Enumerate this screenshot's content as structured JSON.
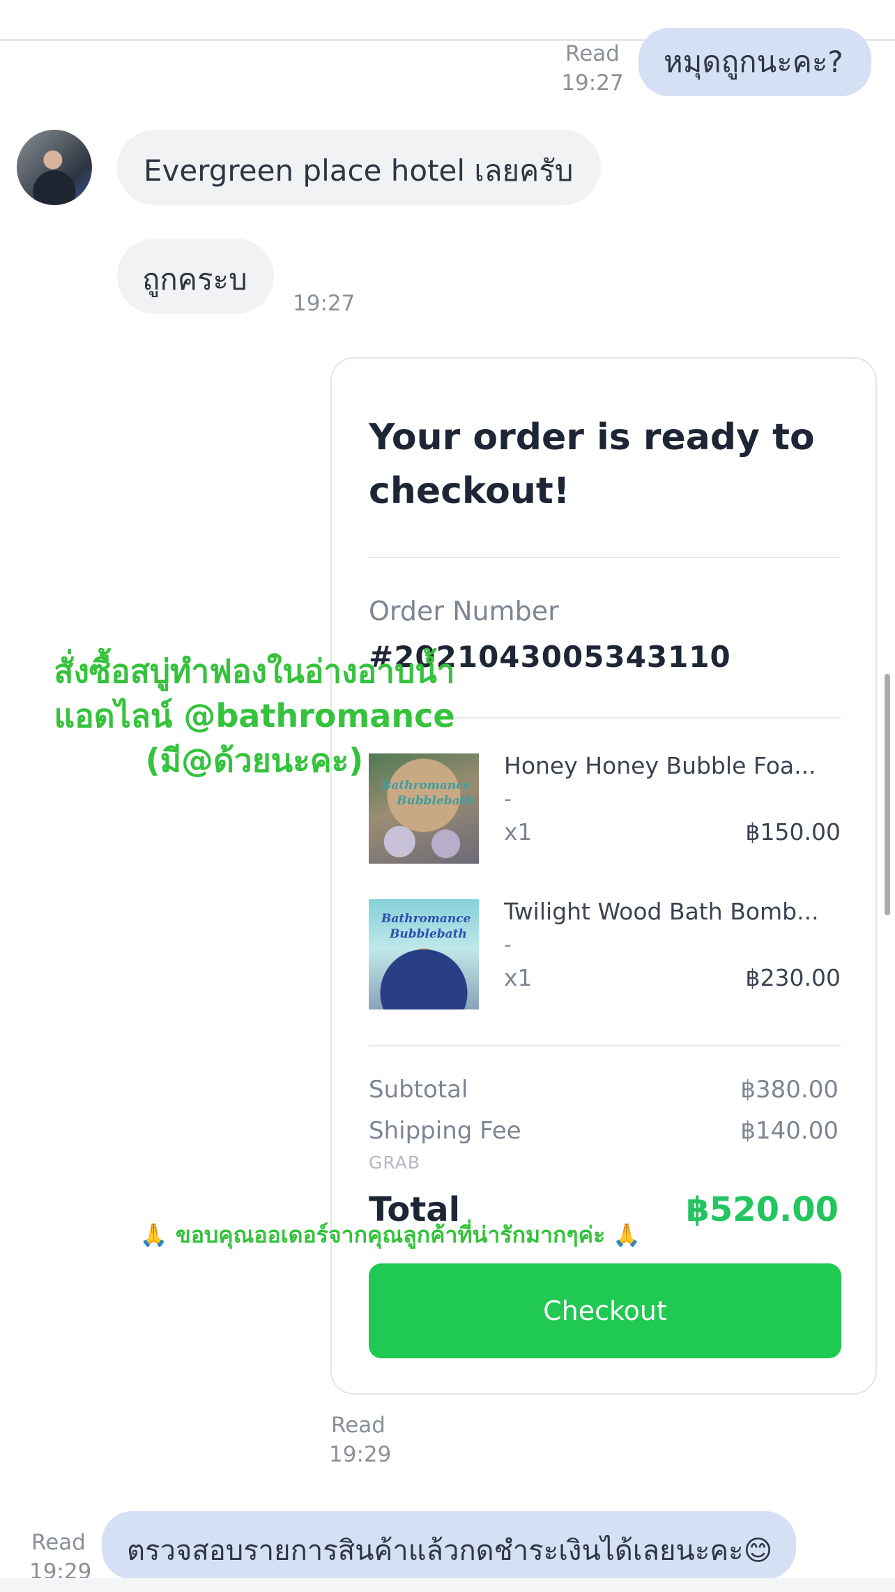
{
  "messages": {
    "out_1": {
      "text": "หมุดถูกนะคะ?",
      "status": "Read",
      "time": "19:27"
    },
    "in_1": {
      "text": "Evergreen place hotel เลยครับ"
    },
    "in_2": {
      "text": "ถูกคระบ",
      "time": "19:27"
    },
    "card_meta": {
      "status": "Read",
      "time": "19:29"
    },
    "out_2": {
      "text": "ตรวจสอบรายการสินค้าแล้วกดชำระเงินได้เลยนะคะ😊",
      "status": "Read",
      "time": "19:29"
    }
  },
  "order_card": {
    "title": "Your order is ready to checkout!",
    "order_label": "Order Number",
    "order_number": "#2021043005343110",
    "items": [
      {
        "name": "Honey Honey Bubble Foa...",
        "variant": "-",
        "qty": "x1",
        "price": "฿150.00",
        "thumb_caption_1": "Bathromance",
        "thumb_caption_2": "Bubblebath"
      },
      {
        "name": "Twilight Wood Bath Bomb...",
        "variant": "-",
        "qty": "x1",
        "price": "฿230.00",
        "thumb_caption_1": "Bathromance",
        "thumb_caption_2": "Bubblebath"
      }
    ],
    "subtotal_label": "Subtotal",
    "subtotal": "฿380.00",
    "shipping_label": "Shipping Fee",
    "shipping": "฿140.00",
    "shipping_method": "GRAB",
    "total_label": "Total",
    "total": "฿520.00",
    "checkout_label": "Checkout"
  },
  "overlay": {
    "line_1": "สั่งซื้อสบู่ทำฟองในอ่างอาบน้ำ",
    "line_2": "แอดไลน์ @bathromance",
    "line_3": "(มี@ด้วยนะคะ)",
    "thanks": "🙏 ขอบคุณออเดอร์จากคุณลูกค้าที่น่ารักมากๆค่ะ 🙏"
  },
  "colors": {
    "outgoing_bubble": "#d6e0f5",
    "incoming_bubble": "#f1f2f4",
    "checkout_green": "#20c951",
    "total_green": "#22c55e",
    "promo_green": "#35c23c"
  },
  "icons": {
    "avatar": "contact-avatar-photo"
  }
}
